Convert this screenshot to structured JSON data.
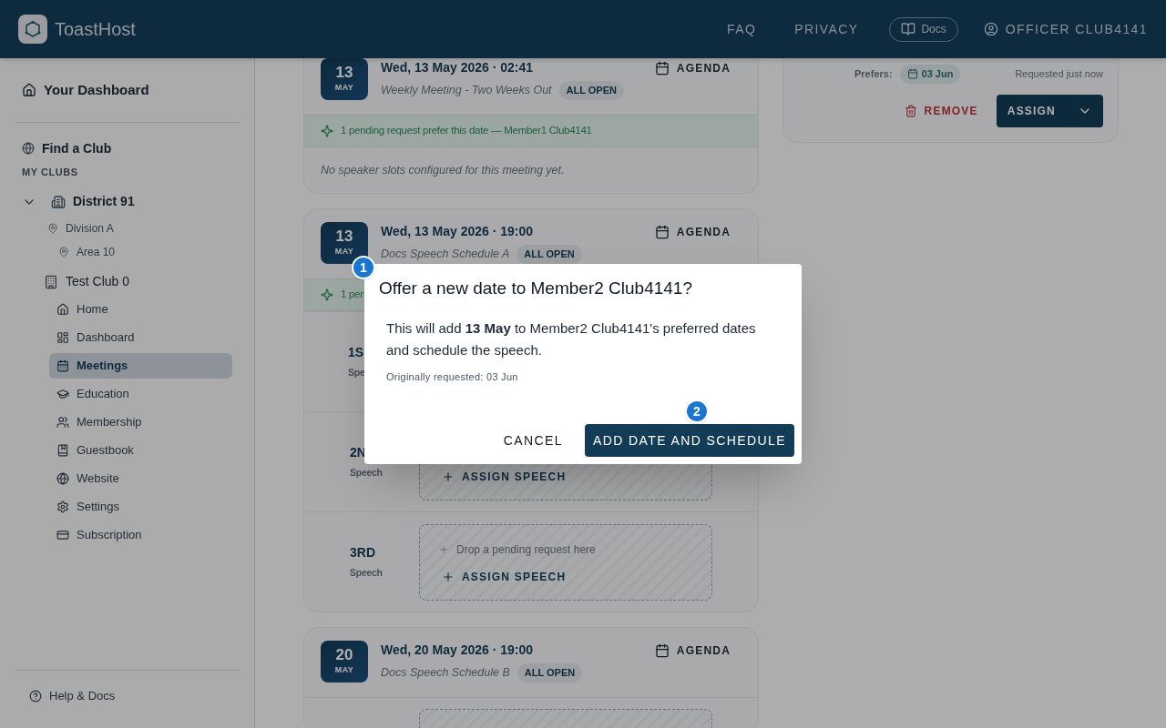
{
  "header": {
    "brand": "ToastHost",
    "nav": [
      "FAQ",
      "PRIVACY"
    ],
    "docs": "Docs",
    "user": "OFFICER CLUB4141"
  },
  "sidebar": {
    "dashboard": "Your Dashboard",
    "find": "Find a Club",
    "section": "MY CLUBS",
    "tree": [
      {
        "label": "District 91",
        "kind": "district",
        "expanded": true,
        "children": [
          {
            "label": "Division A",
            "kind": "location",
            "children": [
              {
                "label": "Area 10",
                "kind": "location"
              }
            ]
          }
        ]
      },
      {
        "label": "Test Club 0",
        "kind": "club",
        "expanded": true,
        "children": [
          {
            "label": "Home",
            "kind": "home",
            "selected": false
          },
          {
            "label": "Dashboard",
            "kind": "dashboard",
            "selected": false
          },
          {
            "label": "Meetings",
            "kind": "meetings",
            "selected": true
          },
          {
            "label": "Education",
            "kind": "education",
            "selected": false
          },
          {
            "label": "Membership",
            "kind": "membership",
            "selected": false
          },
          {
            "label": "Guestbook",
            "kind": "guestbook",
            "selected": false
          },
          {
            "label": "Website",
            "kind": "website",
            "selected": false
          },
          {
            "label": "Settings",
            "kind": "settings",
            "selected": false
          },
          {
            "label": "Subscription",
            "kind": "subscription",
            "selected": false
          }
        ]
      }
    ],
    "help": "Help & Docs"
  },
  "meetings": [
    {
      "day": "13",
      "month": "MAY",
      "title": "Wed, 13 May 2026 · 02:41",
      "subtitle": "Weekly Meeting - Two Weeks Out",
      "badge": "ALL OPEN",
      "agenda": "AGENDA",
      "banner": "1 pending request prefer this date — Member1 Club4141",
      "note": "No speaker slots configured for this meeting yet."
    },
    {
      "day": "13",
      "month": "MAY",
      "title": "Wed, 13 May 2026 · 19:00",
      "subtitle": "Docs Speech Schedule A",
      "badge": "ALL OPEN",
      "agenda": "AGENDA",
      "banner": "1 pen",
      "slots": [
        {
          "kind": "hidden",
          "ordinal": "1S",
          "label": "Spe"
        },
        {
          "kind": "slot",
          "ordinal": "2N",
          "label": "Speech",
          "assign": "ASSIGN SPEECH"
        },
        {
          "kind": "slot",
          "ordinal": "3RD",
          "label": "Speech",
          "drop": "Drop a pending request here",
          "assign": "ASSIGN SPEECH"
        }
      ]
    },
    {
      "day": "20",
      "month": "MAY",
      "title": "Wed, 20 May 2026 · 19:00",
      "subtitle": "Docs Speech Schedule B",
      "badge": "ALL OPEN",
      "agenda": "AGENDA",
      "slots": [
        {
          "kind": "cut"
        }
      ]
    }
  ],
  "request": {
    "prefers_label": "Prefers:",
    "prefers_date": "03 Jun",
    "requested": "Requested just now",
    "remove": "REMOVE",
    "assign": "ASSIGN"
  },
  "dialog": {
    "title": "Offer a new date to Member2 Club4141?",
    "body": "This will add **13 May** to Member2 Club4141's preferred dates and schedule the speech.",
    "note": "Originally requested: 03 Jun",
    "cancel": "CANCEL",
    "confirm": "ADD DATE AND SCHEDULE",
    "markers": [
      "1",
      "2"
    ]
  }
}
